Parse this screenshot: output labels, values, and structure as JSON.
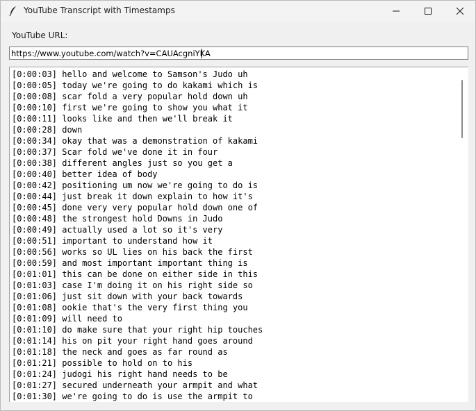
{
  "window": {
    "title": "YouTube Transcript with Timestamps",
    "icon": "feather-icon",
    "controls": [
      "minimize-icon",
      "maximize-icon",
      "close-icon"
    ]
  },
  "form": {
    "url_label": "YouTube URL:",
    "url_value": "https://www.youtube.com/watch?v=CAUAcgniYKA"
  },
  "transcript": [
    {
      "time": "[0:00:03]",
      "text": "hello and welcome to Samson's Judo uh"
    },
    {
      "time": "[0:00:05]",
      "text": "today we're going to do kakami which is"
    },
    {
      "time": "[0:00:08]",
      "text": "scar fold a very popular hold down uh"
    },
    {
      "time": "[0:00:10]",
      "text": "first we're going to show you what it"
    },
    {
      "time": "[0:00:11]",
      "text": "looks like and then we'll break it"
    },
    {
      "time": "[0:00:28]",
      "text": "down"
    },
    {
      "time": "[0:00:34]",
      "text": "okay that was a demonstration of kakami"
    },
    {
      "time": "[0:00:37]",
      "text": "Scar fold we've done it in four"
    },
    {
      "time": "[0:00:38]",
      "text": "different angles just so you get a"
    },
    {
      "time": "[0:00:40]",
      "text": "better idea of body"
    },
    {
      "time": "[0:00:42]",
      "text": "positioning um now we're going to do is"
    },
    {
      "time": "[0:00:44]",
      "text": "just break it down explain to how it's"
    },
    {
      "time": "[0:00:45]",
      "text": "done very very popular hold down one of"
    },
    {
      "time": "[0:00:48]",
      "text": "the strongest hold Downs in Judo"
    },
    {
      "time": "[0:00:49]",
      "text": "actually used a lot so it's very"
    },
    {
      "time": "[0:00:51]",
      "text": "important to understand how it"
    },
    {
      "time": "[0:00:56]",
      "text": "works so UL lies on his back the first"
    },
    {
      "time": "[0:00:59]",
      "text": "and most important important thing is"
    },
    {
      "time": "[0:01:01]",
      "text": "this can be done on either side in this"
    },
    {
      "time": "[0:01:03]",
      "text": "case I'm doing it on his right side so"
    },
    {
      "time": "[0:01:06]",
      "text": "just sit down with your back towards"
    },
    {
      "time": "[0:01:08]",
      "text": "ookie that's the very first thing you"
    },
    {
      "time": "[0:01:09]",
      "text": "will need to"
    },
    {
      "time": "[0:01:10]",
      "text": "do make sure that your right hip touches"
    },
    {
      "time": "[0:01:14]",
      "text": "his on pit your right hand goes around"
    },
    {
      "time": "[0:01:18]",
      "text": "the neck and goes as far round as"
    },
    {
      "time": "[0:01:21]",
      "text": "possible to hold on to his"
    },
    {
      "time": "[0:01:24]",
      "text": "judogi his right hand needs to be"
    },
    {
      "time": "[0:01:27]",
      "text": "secured underneath your armpit and what"
    },
    {
      "time": "[0:01:30]",
      "text": "we're going to do is use the armpit to"
    }
  ]
}
